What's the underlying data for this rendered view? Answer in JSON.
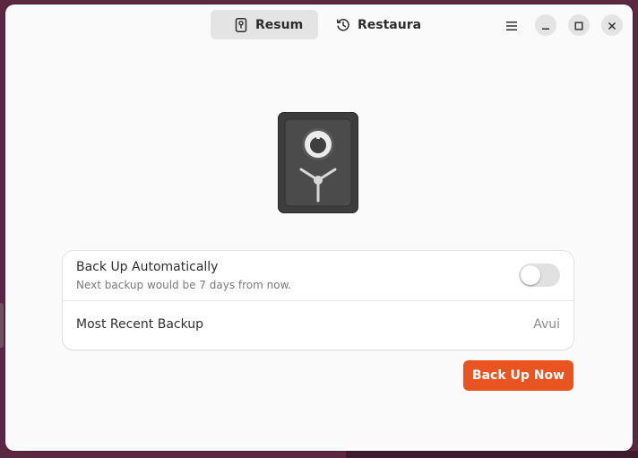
{
  "colors": {
    "accent": "#e95420",
    "window_bg": "#fafafa",
    "desktop_bg": "#5b2742"
  },
  "header": {
    "tabs": [
      {
        "label": "Resum",
        "icon": "safe-icon",
        "active": true
      },
      {
        "label": "Restaura",
        "icon": "history-icon",
        "active": false
      }
    ],
    "menu_icon": "hamburger-menu-icon",
    "window_controls": [
      "minimize-icon",
      "maximize-icon",
      "close-icon"
    ]
  },
  "hero": {
    "icon": "safe-vault-icon"
  },
  "settings": {
    "auto_backup": {
      "title": "Back Up Automatically",
      "subtitle": "Next backup would be 7 days from now.",
      "enabled": false
    },
    "recent_backup": {
      "title": "Most Recent Backup",
      "value": "Avui"
    }
  },
  "actions": {
    "backup_now_label": "Back Up Now"
  }
}
